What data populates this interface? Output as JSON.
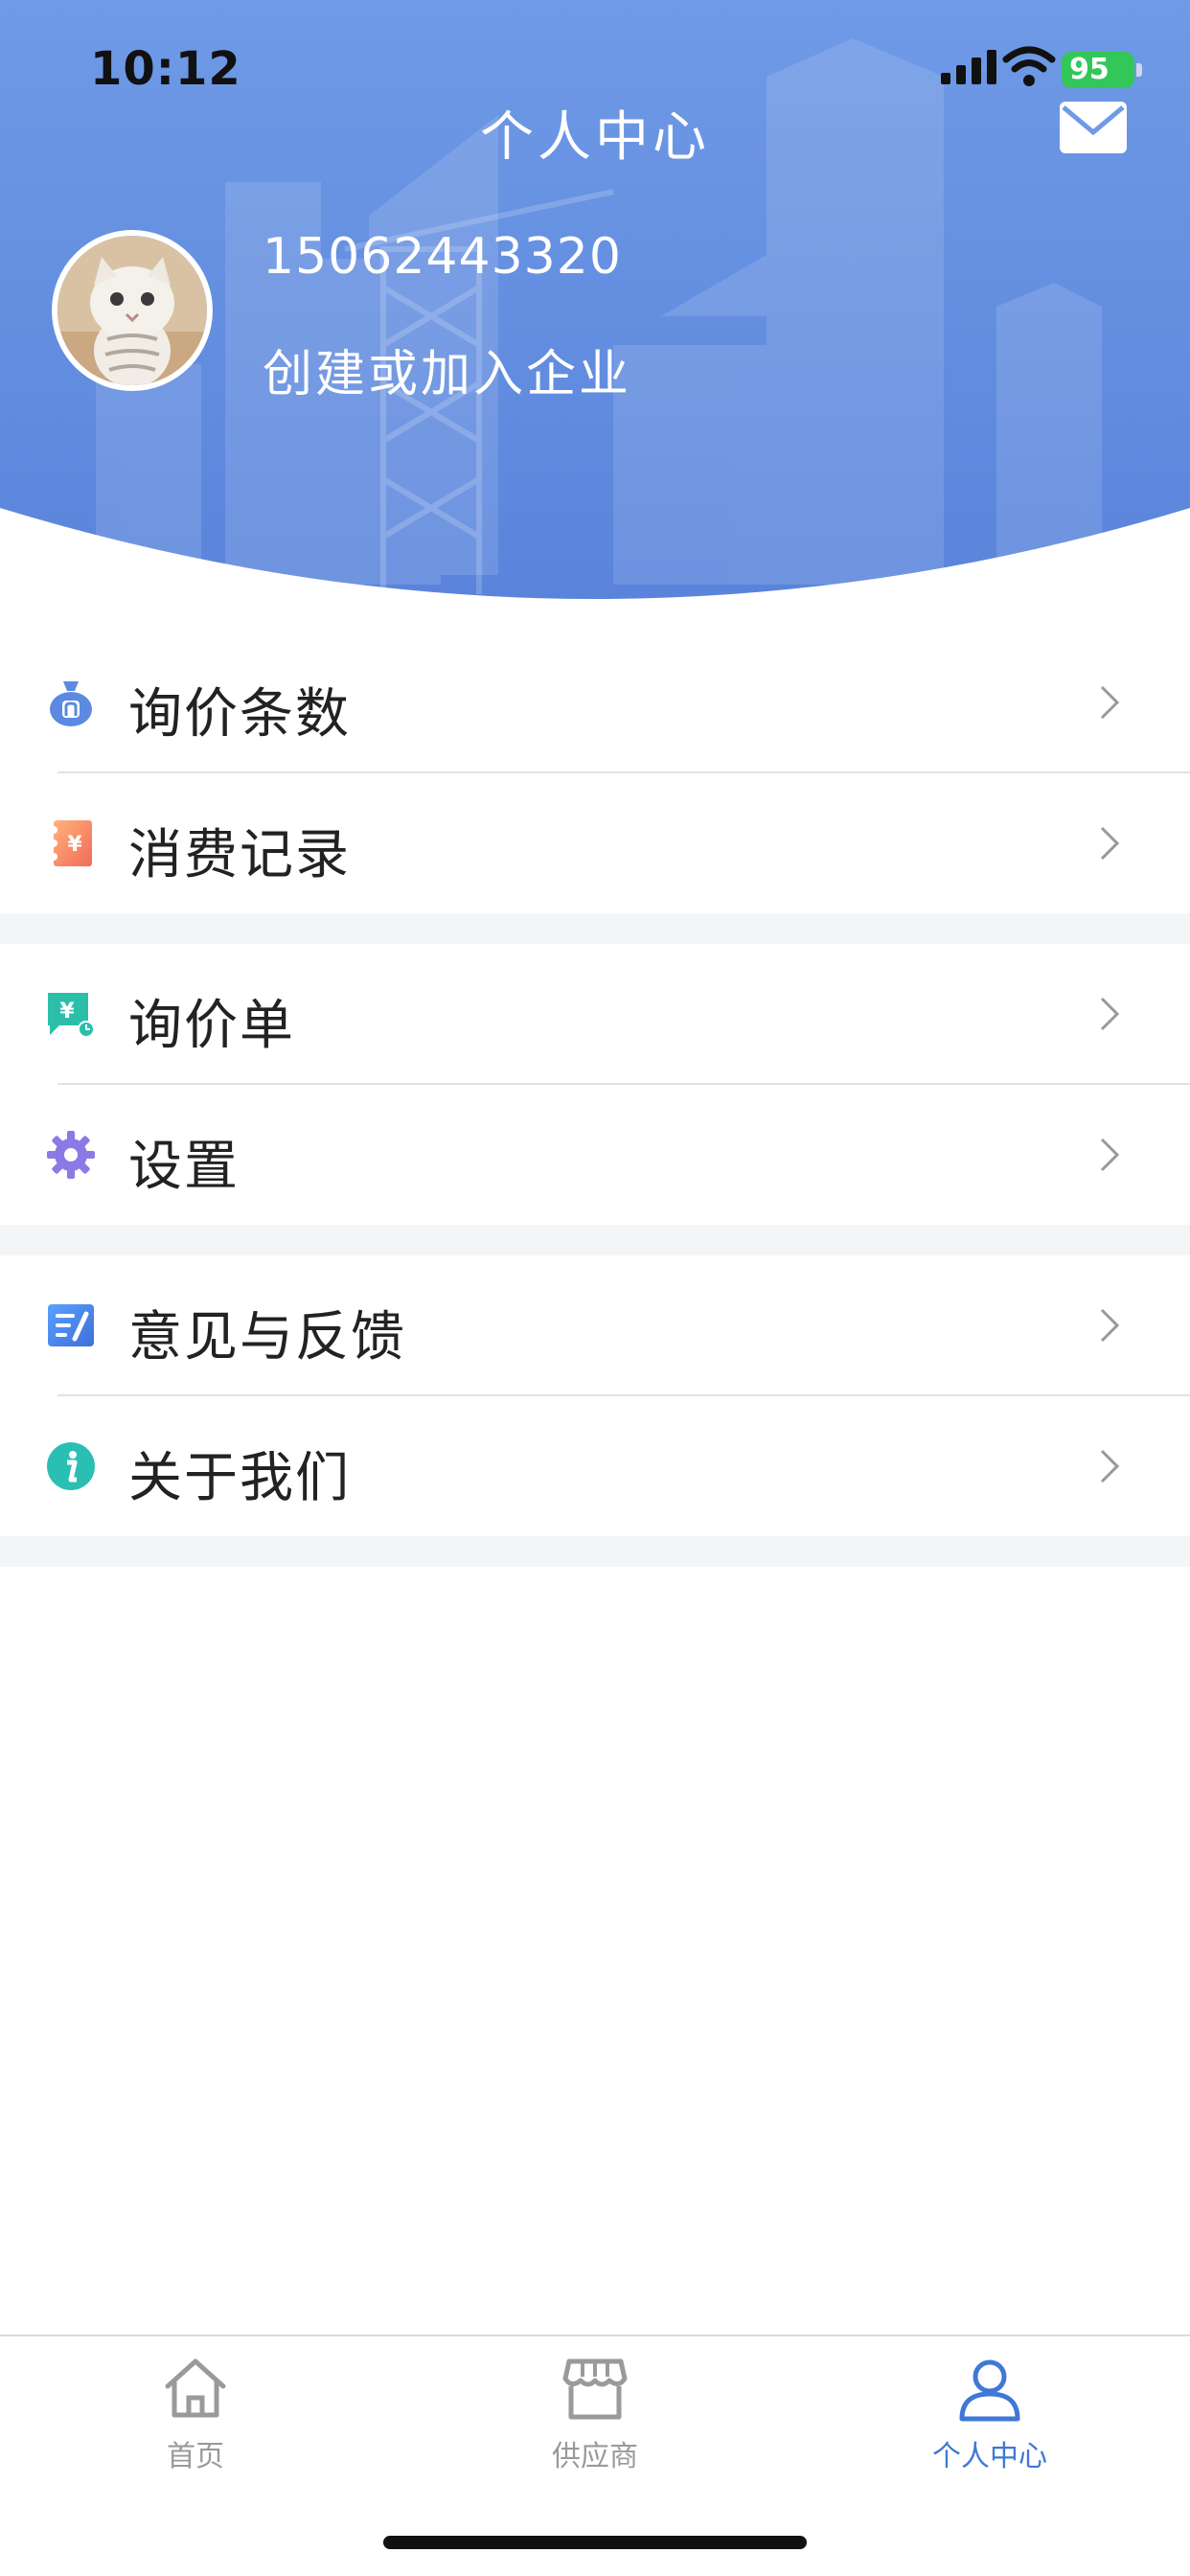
{
  "status_bar": {
    "time": "10:12",
    "battery": "95"
  },
  "header": {
    "title": "个人中心",
    "phone": "15062443320",
    "join_company": "创建或加入企业"
  },
  "menu": [
    {
      "label": "询价条数",
      "icon": "money-bag-icon"
    },
    {
      "label": "消费记录",
      "icon": "receipt-icon"
    },
    {
      "label": "询价单",
      "icon": "quote-chat-icon"
    },
    {
      "label": "设置",
      "icon": "gear-icon"
    },
    {
      "label": "意见与反馈",
      "icon": "feedback-edit-icon"
    },
    {
      "label": "关于我们",
      "icon": "info-icon"
    }
  ],
  "tabs": [
    {
      "label": "首页",
      "icon": "home-icon",
      "active": false
    },
    {
      "label": "供应商",
      "icon": "store-icon",
      "active": false
    },
    {
      "label": "个人中心",
      "icon": "person-icon",
      "active": true
    }
  ],
  "colors": {
    "accent": "#3f78d6",
    "header_blue": "#5b8ae0",
    "battery_green": "#33c759"
  }
}
